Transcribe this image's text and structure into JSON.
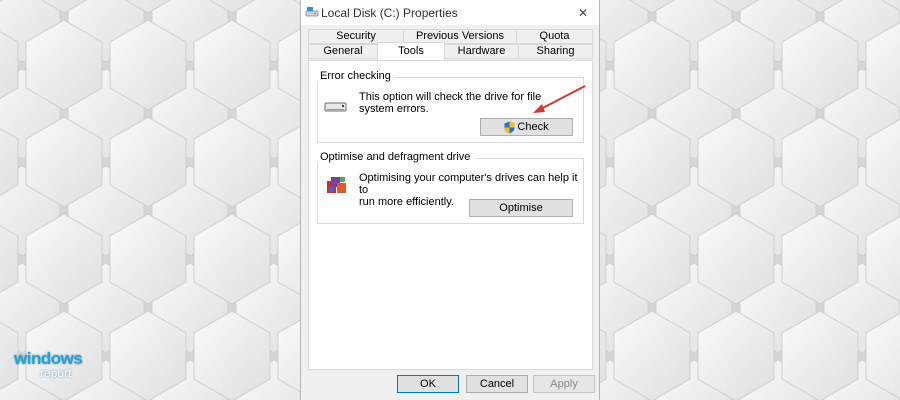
{
  "window": {
    "title": "Local Disk (C:) Properties",
    "close_glyph": "✕"
  },
  "tabs": {
    "row_back": [
      "Security",
      "Previous Versions",
      "Quota"
    ],
    "row_front": [
      "General",
      "Tools",
      "Hardware",
      "Sharing"
    ],
    "active": "Tools"
  },
  "error_checking": {
    "label": "Error checking",
    "description_line1": "This option will check the drive for file",
    "description_line2": "system errors.",
    "button": "Check"
  },
  "optimise": {
    "label": "Optimise and defragment drive",
    "description_line1": "Optimising your computer's drives can help it to",
    "description_line2": "run more efficiently.",
    "button": "Optimise"
  },
  "footer": {
    "ok": "OK",
    "cancel": "Cancel",
    "apply": "Apply"
  },
  "watermark": {
    "brand": "windows",
    "sub": "report"
  },
  "colors": {
    "accent_arrow": "#d9362e",
    "brand_blue": "#27a2d6",
    "window_bg": "#f0f0f0"
  },
  "icons": {
    "title": "drive-icon",
    "close": "close-icon",
    "drive": "drive-icon",
    "shield": "uac-shield-icon",
    "defrag": "defrag-icon"
  }
}
